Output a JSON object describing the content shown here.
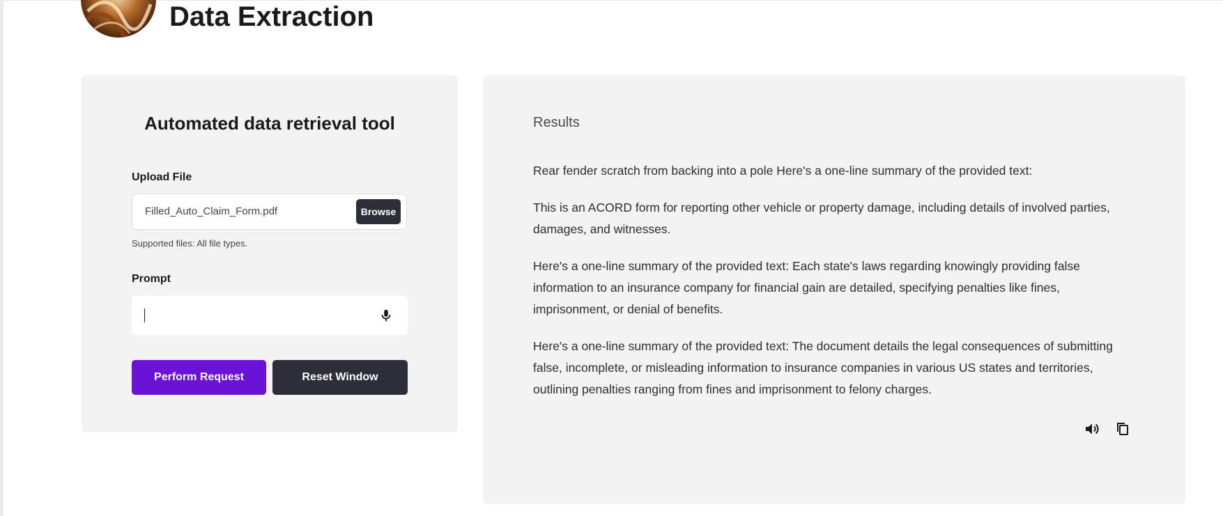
{
  "header": {
    "title": "Data Extraction",
    "avatar_icon": "abstract-swirl-avatar"
  },
  "left_panel": {
    "title": "Automated data retrieval tool",
    "upload": {
      "label": "Upload File",
      "file_name": "Filled_Auto_Claim_Form.pdf",
      "browse_label": "Browse",
      "hint": "Supported files: All file types."
    },
    "prompt": {
      "label": "Prompt",
      "value": "",
      "mic_icon": "microphone-icon"
    },
    "buttons": {
      "perform_label": "Perform Request",
      "reset_label": "Reset Window"
    }
  },
  "results": {
    "title": "Results",
    "paragraphs": [
      "Rear fender scratch from backing into a pole Here's a one-line summary of the provided text:",
      "This is an ACORD form for reporting other vehicle or property damage, including details of involved parties, damages, and witnesses.",
      "Here's a one-line summary of the provided text: Each state's laws regarding knowingly providing false information to an insurance company for financial gain are detailed, specifying penalties like fines, imprisonment, or denial of benefits.",
      "Here's a one-line summary of the provided text: The document details the legal consequences of submitting false, incomplete, or misleading information to insurance companies in various US states and territories, outlining penalties ranging from fines and imprisonment to felony charges."
    ],
    "actions": {
      "speak_icon": "speaker-icon",
      "copy_icon": "copy-icon"
    }
  },
  "colors": {
    "primary": "#6a12d6",
    "dark": "#2d2e3a",
    "panel": "#f3f3f3"
  }
}
